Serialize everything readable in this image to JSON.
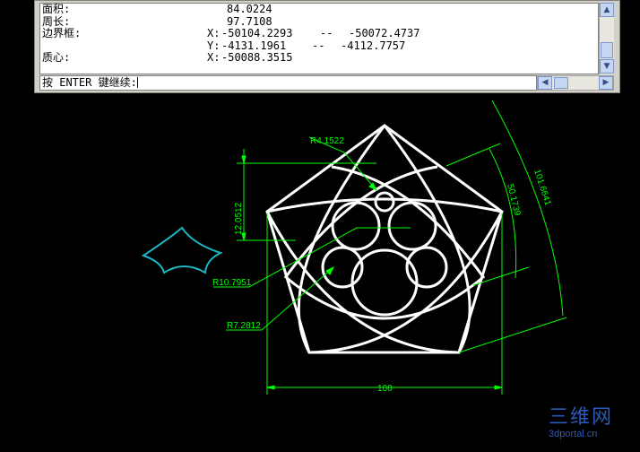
{
  "command_window": {
    "lines": [
      {
        "label": "面积:",
        "value": "84.0224",
        "axis": "",
        "value2": ""
      },
      {
        "label": "周长:",
        "value": "97.7108",
        "axis": "",
        "value2": ""
      },
      {
        "label": "边界框:",
        "axis": "X:",
        "value": "-50104.2293",
        "sep": "--",
        "value2": "-50072.4737"
      },
      {
        "label": "",
        "axis": "Y:",
        "value": "-4131.1961",
        "sep": "--",
        "value2": "-4112.7757"
      },
      {
        "label": "质心:",
        "axis": "X:",
        "value": "-50088.3515",
        "sep": "",
        "value2": ""
      }
    ],
    "prompt": "按 ENTER 键继续:"
  },
  "dimensions": {
    "r_top": "R4.1522",
    "r_large": "R10.7951",
    "r_small": "R7.2812",
    "height": "12.0512",
    "width": "100",
    "arc_outer": "101.6641",
    "arc_inner": "50.1739"
  },
  "colors": {
    "geometry": "#ffffff",
    "dimension": "#00ff00",
    "star_outline": "#19b7c4",
    "background": "#000000",
    "watermark": "#2a5ab8"
  },
  "watermark": {
    "main": "三维网",
    "sub": "3dportal.cn"
  }
}
